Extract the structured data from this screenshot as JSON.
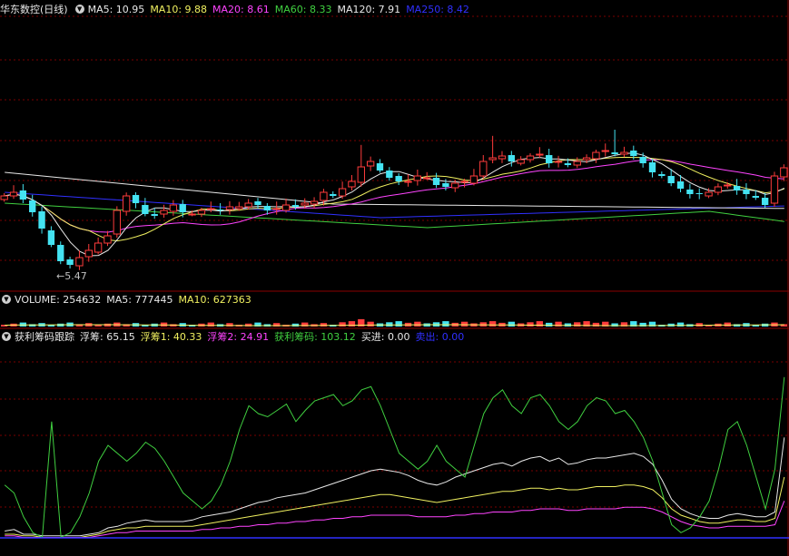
{
  "colors": {
    "bg": "#000000",
    "frame": "#8b0000",
    "grid": "#7a0000",
    "up": "#ff3c3c",
    "down": "#44e3f2",
    "white": "#e8e8e8",
    "yellow": "#f0f060",
    "magenta": "#ff44ff",
    "green": "#40d040",
    "blue": "#3030ff"
  },
  "main_panel": {
    "title": "华东数控(日线)",
    "ma5": "MA5: 10.95",
    "ma10": "MA10: 9.88",
    "ma20": "MA20: 8.61",
    "ma60": "MA60: 8.33",
    "ma120": "MA120: 7.91",
    "ma250": "MA250: 8.42",
    "low_label": "←5.47"
  },
  "volume_panel": {
    "title": "VOLUME: 254632",
    "ma5": "MA5: 777445",
    "ma10": "MA10: 627363"
  },
  "indicator_panel": {
    "title": "获利筹码跟踪",
    "float": "浮筹: 65.15",
    "float1": "浮筹1: 40.33",
    "float2": "浮筹2: 24.91",
    "profit": "获利筹码: 103.12",
    "buy": "买进: 0.00",
    "sell": "卖出: 0.00"
  },
  "chart_data": [
    {
      "type": "candlestick",
      "title": "华东数控(日线)",
      "series_legend": [
        "MA5",
        "MA10",
        "MA20",
        "MA60",
        "MA120",
        "MA250"
      ],
      "annotation": "←5.47",
      "price_path": [
        9.4,
        9.6,
        9.2,
        8.5,
        7.6,
        6.7,
        5.8,
        5.6,
        6.0,
        6.4,
        6.8,
        7.2,
        8.6,
        9.4,
        9.0,
        8.4,
        8.3,
        8.6,
        8.9,
        8.5,
        8.4,
        8.6,
        8.7,
        8.6,
        8.8,
        8.8,
        9.0,
        8.9,
        8.6,
        8.7,
        8.9,
        8.8,
        9.0,
        9.1,
        9.6,
        9.4,
        9.8,
        10.2,
        11.0,
        11.3,
        10.8,
        10.4,
        10.2,
        10.2,
        10.5,
        10.4,
        10.0,
        9.9,
        10.1,
        10.2,
        10.5,
        11.3,
        11.5,
        11.6,
        11.3,
        11.4,
        11.6,
        11.7,
        11.2,
        11.3,
        11.1,
        11.3,
        11.5,
        11.8,
        11.9,
        11.7,
        11.8,
        11.6,
        11.2,
        10.7,
        10.5,
        10.1,
        9.8,
        9.5,
        9.5,
        9.6,
        9.9,
        10.0,
        9.7,
        9.5,
        9.3,
        8.9,
        10.5,
        10.95
      ]
    },
    {
      "type": "bar",
      "title": "VOLUME: 254632",
      "series_legend": [
        "MA5: 777445",
        "MA10: 627363"
      ]
    },
    {
      "type": "line",
      "title": "获利筹码跟踪",
      "series": [
        {
          "name": "浮筹",
          "color": "#e8e8e8",
          "values": [
            6,
            7,
            4,
            4,
            3,
            3,
            3,
            3,
            3,
            4,
            5,
            8,
            9,
            11,
            12,
            13,
            12,
            12,
            12,
            12,
            13,
            15,
            16,
            17,
            18,
            20,
            22,
            24,
            25,
            27,
            28,
            29,
            30,
            32,
            34,
            36,
            38,
            40,
            42,
            44,
            45,
            44,
            43,
            41,
            38,
            36,
            35,
            37,
            40,
            42,
            44,
            46,
            48,
            49,
            47,
            50,
            52,
            53,
            50,
            52,
            48,
            49,
            51,
            52,
            52,
            53,
            54,
            55,
            53,
            48,
            38,
            26,
            20,
            17,
            15,
            14,
            14,
            16,
            17,
            16,
            15,
            15,
            18,
            65
          ]
        },
        {
          "name": "浮筹1",
          "color": "#f0f060",
          "values": [
            4,
            4,
            3,
            3,
            2,
            2,
            2,
            2,
            2,
            3,
            4,
            6,
            7,
            8,
            8,
            9,
            9,
            9,
            9,
            9,
            9,
            10,
            11,
            12,
            13,
            14,
            15,
            16,
            17,
            18,
            19,
            20,
            21,
            22,
            23,
            24,
            25,
            26,
            27,
            28,
            29,
            29,
            28,
            27,
            26,
            25,
            24,
            25,
            26,
            27,
            28,
            29,
            30,
            31,
            31,
            32,
            33,
            33,
            32,
            33,
            32,
            32,
            33,
            34,
            34,
            34,
            35,
            35,
            34,
            32,
            27,
            20,
            16,
            14,
            12,
            11,
            11,
            12,
            13,
            13,
            12,
            12,
            14,
            40
          ]
        },
        {
          "name": "浮筹2",
          "color": "#ff44ff",
          "values": [
            3,
            3,
            2,
            2,
            2,
            2,
            2,
            2,
            2,
            2,
            3,
            4,
            5,
            5,
            6,
            6,
            6,
            6,
            6,
            6,
            6,
            7,
            7,
            8,
            8,
            9,
            9,
            10,
            10,
            11,
            11,
            12,
            12,
            13,
            13,
            14,
            14,
            15,
            15,
            16,
            16,
            16,
            16,
            16,
            15,
            15,
            15,
            15,
            16,
            16,
            17,
            17,
            18,
            18,
            18,
            19,
            19,
            20,
            20,
            20,
            19,
            19,
            20,
            20,
            20,
            20,
            21,
            21,
            21,
            20,
            18,
            15,
            12,
            10,
            9,
            8,
            8,
            9,
            9,
            9,
            9,
            9,
            10,
            25
          ]
        },
        {
          "name": "获利筹码",
          "color": "#40d040",
          "values": [
            35,
            30,
            15,
            5,
            2,
            75,
            2,
            5,
            15,
            30,
            50,
            60,
            55,
            50,
            55,
            62,
            58,
            50,
            40,
            30,
            25,
            20,
            25,
            35,
            50,
            70,
            85,
            80,
            78,
            82,
            86,
            75,
            82,
            88,
            90,
            92,
            85,
            88,
            95,
            97,
            85,
            70,
            55,
            50,
            45,
            50,
            60,
            50,
            45,
            40,
            60,
            80,
            90,
            95,
            85,
            80,
            90,
            92,
            85,
            75,
            70,
            75,
            85,
            90,
            88,
            80,
            82,
            75,
            65,
            50,
            30,
            10,
            5,
            8,
            15,
            25,
            45,
            70,
            75,
            60,
            40,
            20,
            45,
            103
          ]
        }
      ]
    }
  ]
}
